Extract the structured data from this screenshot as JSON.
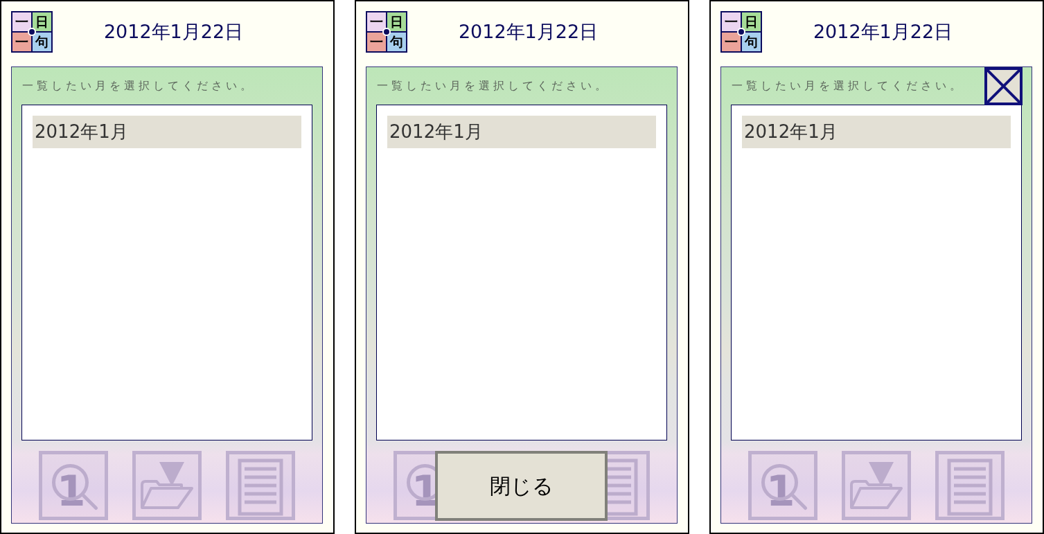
{
  "screens": [
    {
      "logo": {
        "characters": [
          "一",
          "日",
          "一",
          "句"
        ]
      },
      "title": "2012年1月22日",
      "panel": {
        "instruction": "一覧したい月を選択してください。",
        "months": [
          {
            "label": "2012年1月"
          }
        ],
        "toolbar": [
          {
            "kind": "search",
            "digit": "1"
          },
          {
            "kind": "folder"
          },
          {
            "kind": "list"
          }
        ]
      }
    },
    {
      "logo": {
        "characters": [
          "一",
          "日",
          "一",
          "句"
        ]
      },
      "title": "2012年1月22日",
      "panel": {
        "instruction": "一覧したい月を選択してください。",
        "months": [
          {
            "label": "2012年1月"
          }
        ],
        "toolbar": [
          {
            "kind": "search",
            "digit": "1"
          },
          {
            "kind": "list"
          }
        ],
        "close_control": {
          "kind": "text",
          "label": "閉じる"
        }
      }
    },
    {
      "logo": {
        "characters": [
          "一",
          "日",
          "一",
          "句"
        ]
      },
      "title": "2012年1月22日",
      "panel": {
        "instruction": "一覧したい月を選択してください。",
        "months": [
          {
            "label": "2012年1月"
          }
        ],
        "toolbar": [
          {
            "kind": "search",
            "digit": "1"
          },
          {
            "kind": "folder"
          },
          {
            "kind": "list"
          }
        ],
        "close_control": {
          "kind": "x"
        }
      }
    }
  ]
}
